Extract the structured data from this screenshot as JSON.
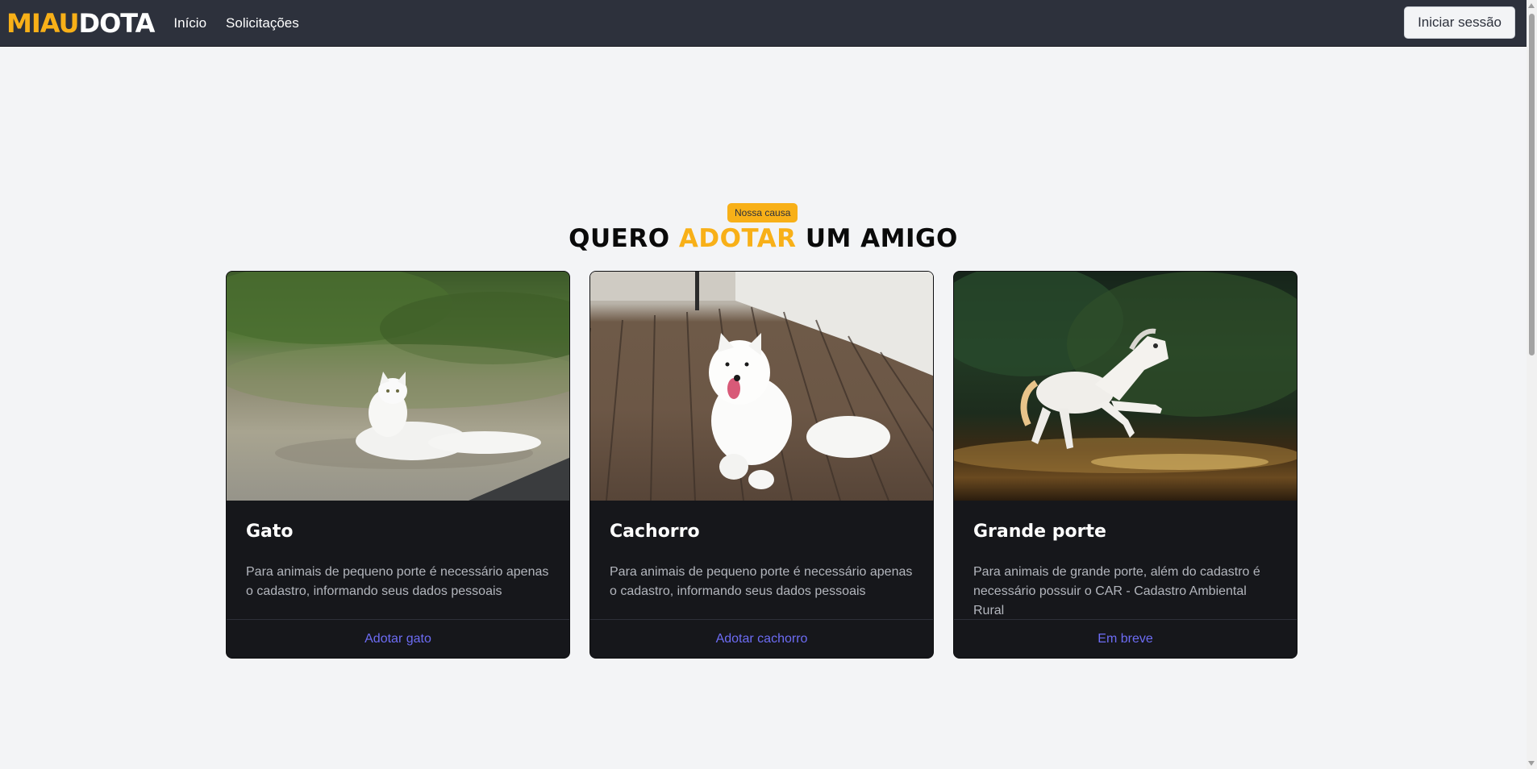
{
  "header": {
    "logo_part1": "MIAU",
    "logo_part2": "DOTA",
    "nav": [
      {
        "label": "Início"
      },
      {
        "label": "Solicitações"
      }
    ],
    "login_label": "Iniciar sessão"
  },
  "hero": {
    "badge": "Nossa causa",
    "title_part1": "QUERO ",
    "title_accent": "ADOTAR",
    "title_part2": " UM AMIGO"
  },
  "cards": [
    {
      "image": "white-cat-photo",
      "title": "Gato",
      "text": "Para animais de pequeno porte é necessário apenas o cadastro, informando seus dados pessoais",
      "link": "Adotar gato"
    },
    {
      "image": "white-dog-photo",
      "title": "Cachorro",
      "text": "Para animais de pequeno porte é necessário apenas o cadastro, informando seus dados pessoais",
      "link": "Adotar cachorro"
    },
    {
      "image": "white-horse-photo",
      "title": "Grande porte",
      "text": "Para animais de grande porte, além do cadastro é necessário possuir o CAR - Cadastro Ambiental Rural",
      "link": "Em breve"
    }
  ],
  "colors": {
    "brand_yellow": "#f8b018",
    "navbar_bg": "#2d313c",
    "card_bg": "#16171b",
    "link_color": "#6d6cf4",
    "page_bg": "#f3f4f6"
  }
}
